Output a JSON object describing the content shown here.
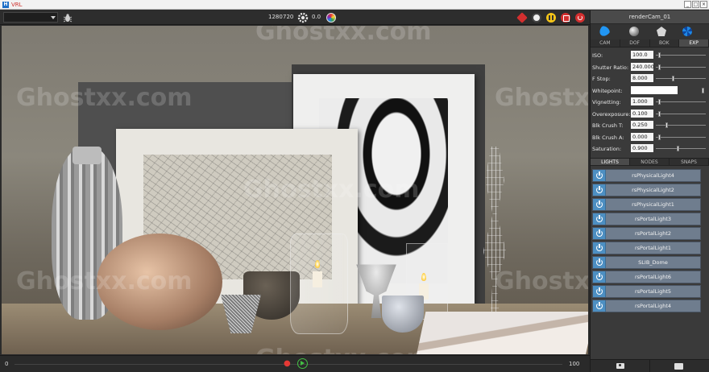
{
  "window": {
    "title": "VRL",
    "app_icon": "H",
    "controls": [
      "_",
      "□",
      "×"
    ]
  },
  "toolbar": {
    "camera_select_value": "",
    "res_width": "1280",
    "res_height": "720",
    "exposure_value": "0.0",
    "icons": [
      "bug-icon",
      "gear-icon",
      "color-wheel-icon",
      "cube-icon",
      "settings-icon",
      "pause-icon",
      "stop-icon",
      "refresh-icon"
    ]
  },
  "viewport": {
    "watermarks": [
      "Ghostxx.com",
      "Ghostxx.com",
      "Ghostxx.com",
      "Ghostxx.com",
      "Ghostxx.com",
      "Ghostxx.com",
      "Ghostxx.com"
    ]
  },
  "statusbar": {
    "start_frame": "0",
    "end_frame": "100"
  },
  "panel": {
    "title": "renderCam_01",
    "tabs": [
      "CAM",
      "DOF",
      "BOK",
      "EXP"
    ],
    "active_tab": "EXP",
    "params": [
      {
        "label": "ISO:",
        "value": "100.0",
        "slider": 0.05
      },
      {
        "label": "Shutter Ratio:",
        "value": "240.000",
        "slider": 0.05
      },
      {
        "label": "F Stop:",
        "value": "8.000",
        "slider": 0.35
      },
      {
        "label": "Whitepoint:",
        "value": "",
        "slider": 0.95
      },
      {
        "label": "Vignetting:",
        "value": "1.000",
        "slider": 0.05
      },
      {
        "label": "Overexposure:",
        "value": "0.100",
        "slider": 0.05
      },
      {
        "label": "Blk Crush T:",
        "value": "0.250",
        "slider": 0.2
      },
      {
        "label": "Blk Crush A:",
        "value": "0.000",
        "slider": 0.05
      },
      {
        "label": "Saturation:",
        "value": "0.900",
        "slider": 0.45
      }
    ],
    "lower_tabs": [
      "LIGHTS",
      "NODES",
      "SNAPS"
    ],
    "active_lower_tab": "LIGHTS",
    "lights": [
      "rsPhysicalLight4",
      "rsPhysicalLight2",
      "rsPhysicalLight1",
      "rsPortalLight3",
      "rsPortalLight2",
      "rsPortalLight1",
      "SLIB_Dome",
      "rsPortalLight6",
      "rsPortalLight5",
      "rsPortalLight4"
    ],
    "bottom_icons": [
      "camera-icon",
      "folder-icon"
    ]
  },
  "colors": {
    "accent": "#4d8fc2",
    "light_row": "#6f7d8e",
    "background": "#2b2b2b"
  }
}
